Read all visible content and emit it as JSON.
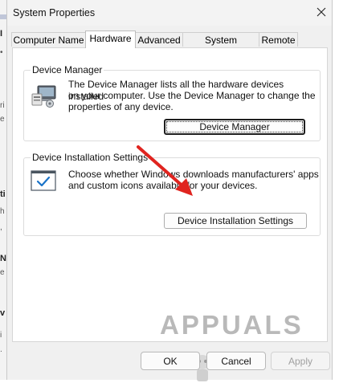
{
  "window": {
    "title": "System Properties"
  },
  "tabs": [
    {
      "label": "Computer Name",
      "active": false
    },
    {
      "label": "Hardware",
      "active": true
    },
    {
      "label": "Advanced",
      "active": false
    },
    {
      "label": "System Protection",
      "active": false
    },
    {
      "label": "Remote",
      "active": false
    }
  ],
  "device_manager": {
    "legend": "Device Manager",
    "description_lines": [
      "The Device Manager lists all the hardware devices installed",
      "on your computer. Use the Device Manager to change the",
      "properties of any device."
    ],
    "button_label": "Device Manager"
  },
  "device_installation": {
    "legend": "Device Installation Settings",
    "description_lines": [
      "Choose whether Windows downloads manufacturers' apps",
      "and custom icons available for your devices."
    ],
    "button_label": "Device Installation Settings"
  },
  "dialog_buttons": {
    "ok": "OK",
    "cancel": "Cancel",
    "apply": "Apply"
  },
  "watermark": "APPUALS",
  "icons": {
    "close": "close-icon",
    "device_manager": "device-manager-icon",
    "installation": "checkbox-window-icon",
    "annotation": "red-arrow-annotation"
  },
  "colors": {
    "arrow": "#e0241f",
    "check": "#1a73c8",
    "window_bg": "#f0f0f0",
    "panel_bg": "#ffffff"
  }
}
